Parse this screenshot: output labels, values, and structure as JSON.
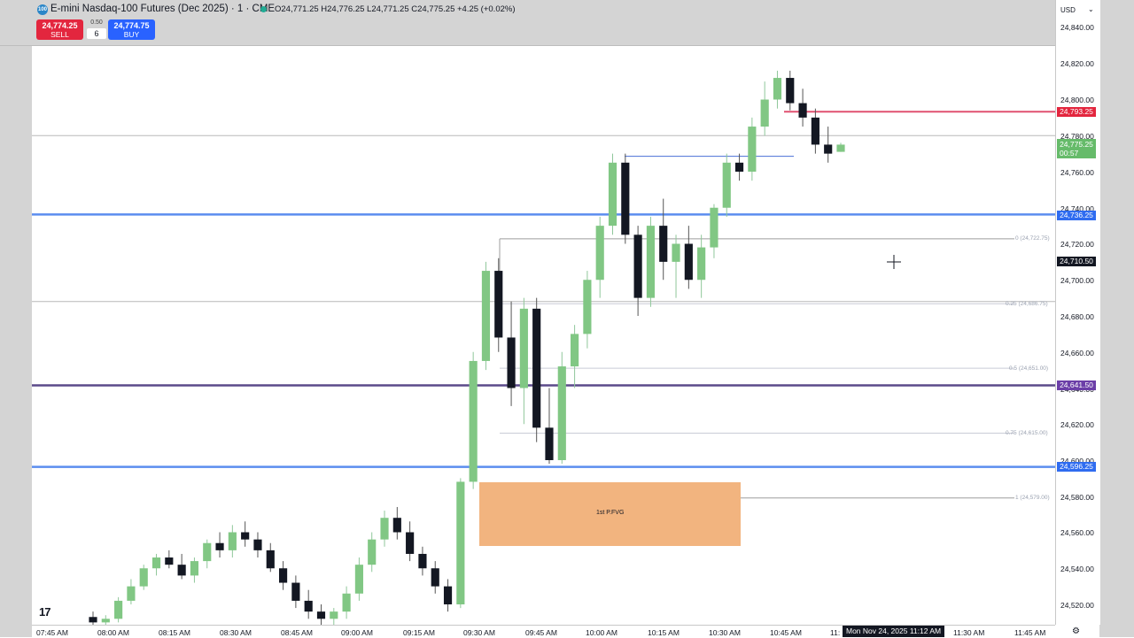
{
  "header": {
    "logo_text": "100",
    "symbol_title": "E-mini Nasdaq-100 Futures (Dec 2025) · 1 · CME",
    "ohlc": "O24,771.25 H24,776.25 L24,771.25 C24,775.25 +4.25 (+0.02%)",
    "sell_price": "24,774.25",
    "sell_label": "SELL",
    "buy_price": "24,774.75",
    "buy_label": "BUY",
    "spread": "0.50",
    "quantity": "6"
  },
  "price_axis": {
    "currency": "USD",
    "ticks": [
      "24,840.00",
      "24,820.00",
      "24,800.00",
      "24,780.00",
      "24,760.00",
      "24,740.00",
      "24,720.00",
      "24,700.00",
      "24,680.00",
      "24,660.00",
      "24,640.00",
      "24,620.00",
      "24,600.00",
      "24,580.00",
      "24,560.00",
      "24,540.00",
      "24,520.00"
    ],
    "labels": {
      "red_level": "24,793.25",
      "last_price": "24,775.25",
      "countdown": "00:57",
      "blue_top": "24,736.25",
      "crosshair": "24,710.50",
      "purple_level": "24,641.50",
      "blue_bottom": "24,596.25"
    }
  },
  "time_axis": {
    "ticks": [
      "07:45 AM",
      "08:00 AM",
      "08:15 AM",
      "08:30 AM",
      "08:45 AM",
      "09:00 AM",
      "09:15 AM",
      "09:30 AM",
      "09:45 AM",
      "10:00 AM",
      "10:15 AM",
      "10:30 AM",
      "10:45 AM",
      "11:",
      "11:30 AM",
      "11:45 AM"
    ],
    "current": "Mon Nov 24, 2025   11:12 AM"
  },
  "drawings": {
    "fvg_label": "1st P.FVG",
    "fib_levels": [
      "0 (24,722.75)",
      "0.25 (24,686.75)",
      "0.5 (24,651.00)",
      "0.75 (24,615.00)",
      "1 (24,579.00)"
    ]
  },
  "colors": {
    "up": "#81c784",
    "down": "#131722",
    "blue_level": "#5b8def",
    "purple_level": "#5b4a8a",
    "red_level": "#e3263e",
    "fvg": "#f2b47f"
  },
  "chart_data": {
    "type": "candlestick",
    "title": "E-mini Nasdaq-100 Futures (Dec 2025) · 1 · CME",
    "ylim": [
      24510,
      24850
    ],
    "xlabel": "",
    "ylabel": "",
    "horizontal_levels": [
      24793.25,
      24736.25,
      24641.5,
      24596.25
    ],
    "fib_levels": [
      24722.75,
      24686.75,
      24651.0,
      24615.0,
      24579.0
    ],
    "fvg_zone": [
      24553,
      24588
    ],
    "series": [
      {
        "values": [
          [
            24513,
            24516,
            24508,
            24510
          ],
          [
            24510,
            24514,
            24506,
            24512
          ],
          [
            24512,
            24524,
            24510,
            24522
          ],
          [
            24522,
            24534,
            24520,
            24530
          ],
          [
            24530,
            24542,
            24528,
            24540
          ],
          [
            24540,
            24548,
            24536,
            24546
          ],
          [
            24546,
            24550,
            24540,
            24542
          ],
          [
            24542,
            24548,
            24534,
            24536
          ],
          [
            24536,
            24546,
            24532,
            24544
          ],
          [
            24544,
            24556,
            24540,
            24554
          ],
          [
            24554,
            24560,
            24546,
            24550
          ],
          [
            24550,
            24564,
            24546,
            24560
          ],
          [
            24560,
            24566,
            24552,
            24556
          ],
          [
            24556,
            24560,
            24546,
            24550
          ],
          [
            24550,
            24554,
            24538,
            24540
          ],
          [
            24540,
            24544,
            24528,
            24532
          ],
          [
            24532,
            24536,
            24518,
            24522
          ],
          [
            24522,
            24528,
            24512,
            24516
          ],
          [
            24516,
            24520,
            24508,
            24512
          ],
          [
            24512,
            24518,
            24506,
            24516
          ],
          [
            24516,
            24530,
            24512,
            24526
          ],
          [
            24526,
            24546,
            24522,
            24542
          ],
          [
            24542,
            24560,
            24538,
            24556
          ],
          [
            24556,
            24572,
            24552,
            24568
          ],
          [
            24568,
            24574,
            24556,
            24560
          ],
          [
            24560,
            24566,
            24544,
            24548
          ],
          [
            24548,
            24552,
            24536,
            24540
          ],
          [
            24540,
            24544,
            24526,
            24530
          ],
          [
            24530,
            24534,
            24516,
            24520
          ],
          [
            24520,
            24590,
            24518,
            24588
          ],
          [
            24588,
            24660,
            24584,
            24655
          ],
          [
            24655,
            24710,
            24650,
            24705
          ],
          [
            24705,
            24712,
            24660,
            24668
          ],
          [
            24668,
            24688,
            24630,
            24640
          ],
          [
            24640,
            24690,
            24620,
            24684
          ],
          [
            24684,
            24690,
            24610,
            24618
          ],
          [
            24618,
            24640,
            24598,
            24600
          ],
          [
            24600,
            24660,
            24598,
            24652
          ],
          [
            24652,
            24675,
            24640,
            24670
          ],
          [
            24670,
            24705,
            24662,
            24700
          ],
          [
            24700,
            24735,
            24690,
            24730
          ],
          [
            24730,
            24770,
            24725,
            24765
          ],
          [
            24765,
            24770,
            24720,
            24725
          ],
          [
            24725,
            24730,
            24680,
            24690
          ],
          [
            24690,
            24735,
            24685,
            24730
          ],
          [
            24730,
            24745,
            24700,
            24710
          ],
          [
            24710,
            24725,
            24690,
            24720
          ],
          [
            24720,
            24730,
            24695,
            24700
          ],
          [
            24700,
            24725,
            24690,
            24718
          ],
          [
            24718,
            24742,
            24712,
            24740
          ],
          [
            24740,
            24770,
            24735,
            24765
          ],
          [
            24765,
            24770,
            24755,
            24760
          ],
          [
            24760,
            24790,
            24755,
            24785
          ],
          [
            24785,
            24810,
            24780,
            24800
          ],
          [
            24800,
            24816,
            24795,
            24812
          ],
          [
            24812,
            24816,
            24794,
            24798
          ],
          [
            24798,
            24806,
            24785,
            24790
          ],
          [
            24790,
            24795,
            24770,
            24775
          ],
          [
            24775,
            24785,
            24765,
            24770
          ],
          [
            24771,
            24776,
            24771,
            24775
          ]
        ]
      }
    ]
  }
}
